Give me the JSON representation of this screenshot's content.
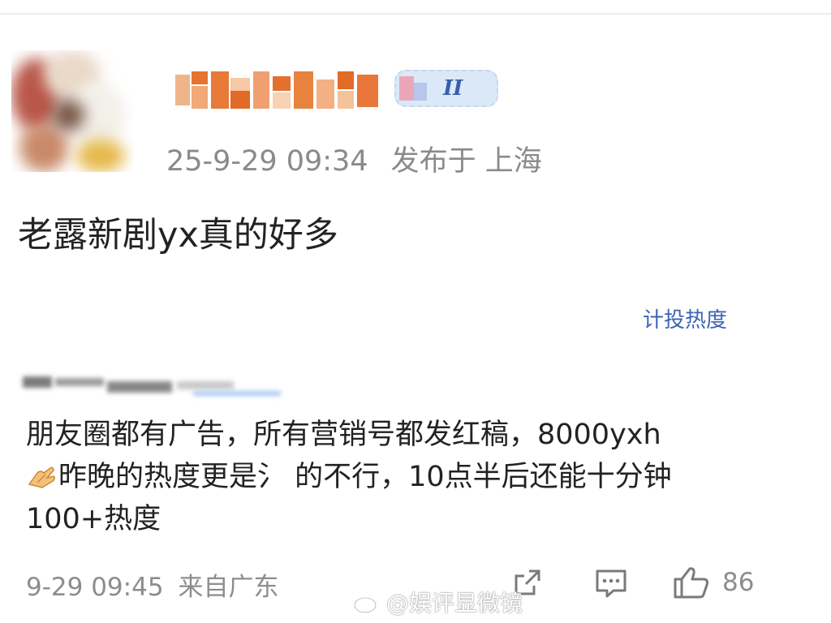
{
  "post": {
    "timestamp": "25-9-29 09:34",
    "location": "发布于 上海",
    "text": "老露新剧yx真的好多",
    "level_badge_number": "II",
    "hot_link_label": "计投热度"
  },
  "comment": {
    "lines": [
      "朋友圈都有广告，所有营销号都发红稿，8000yxh",
      "昨晚的热度更是氵 的不行，10点半后还能十分钟",
      "100+热度"
    ],
    "timestamp": "9-29 09:45",
    "source": "来自广东",
    "like_count": "86"
  },
  "watermark": "@娱评显微镜",
  "icons": [
    "share-icon",
    "comment-icon",
    "like-icon",
    "clap-hands-icon",
    "weibo-logo-icon"
  ],
  "colors": {
    "link": "#3d64b3",
    "meta": "#8a8a8a",
    "text": "#222222"
  }
}
